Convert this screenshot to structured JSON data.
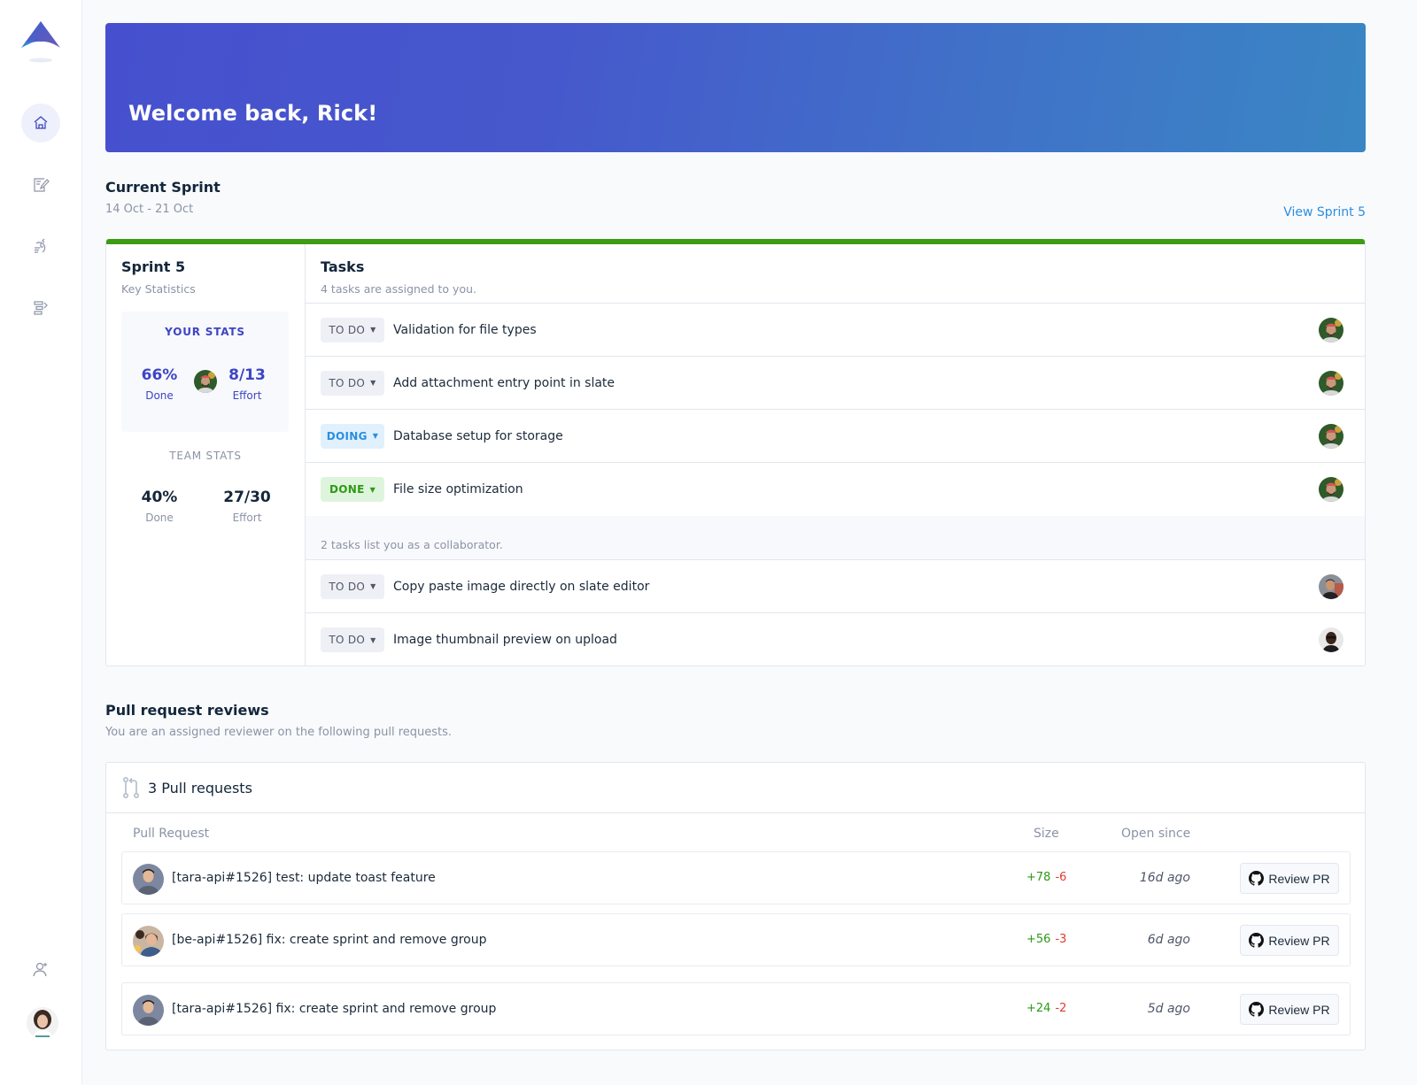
{
  "sidebar": {
    "nav": [
      {
        "icon": "home-icon",
        "active": true
      },
      {
        "icon": "edit-document-icon",
        "active": false
      },
      {
        "icon": "sprint-cycle-icon",
        "active": false
      },
      {
        "icon": "roadmap-icon",
        "active": false
      }
    ],
    "bottom": [
      {
        "icon": "add-user-icon"
      }
    ]
  },
  "banner": {
    "title": "Welcome back, Rick!"
  },
  "sprint_section": {
    "title": "Current Sprint",
    "dates": "14 Oct - 21 Oct",
    "view_link": "View Sprint 5"
  },
  "sprint_card": {
    "accent_color": "#3c9c14",
    "name": "Sprint 5",
    "subtitle": "Key Statistics",
    "your_stats": {
      "label": "YOUR STATS",
      "done_value": "66%",
      "done_caption": "Done",
      "effort_value": "8/13",
      "effort_caption": "Effort"
    },
    "team_stats": {
      "label": "TEAM STATS",
      "done_value": "40%",
      "done_caption": "Done",
      "effort_value": "27/30",
      "effort_caption": "Effort"
    }
  },
  "tasks": {
    "title": "Tasks",
    "assigned_sub": "4 tasks are assigned to you.",
    "assigned": [
      {
        "status": "TO DO",
        "title": "Validation for file types"
      },
      {
        "status": "TO DO",
        "title": "Add attachment entry point in slate"
      },
      {
        "status": "DOING",
        "title": "Database setup for storage"
      },
      {
        "status": "DONE",
        "title": "File size optimization"
      }
    ],
    "collab_sub": "2 tasks list you as a collaborator.",
    "collab": [
      {
        "status": "TO DO",
        "title": "Copy paste image directly on slate editor"
      },
      {
        "status": "TO DO",
        "title": "Image thumbnail preview on upload"
      }
    ]
  },
  "pr_section": {
    "title": "Pull request reviews",
    "subtitle": "You are an assigned reviewer on the following pull requests.",
    "count_label": "3 Pull requests",
    "columns": {
      "pr": "Pull Request",
      "size": "Size",
      "open": "Open since"
    },
    "rows": [
      {
        "title": "[tara-api#1526] test: update toast feature",
        "add": "+78",
        "del": "-6",
        "open": "16d ago",
        "button": "Review PR"
      },
      {
        "title": "[be-api#1526] fix: create sprint and remove group",
        "add": "+56",
        "del": "-3",
        "open": "6d ago",
        "button": "Review PR"
      },
      {
        "title": "[tara-api#1526] fix: create sprint and remove group",
        "add": "+24",
        "del": "-2",
        "open": "5d ago",
        "button": "Review PR"
      }
    ]
  },
  "colors": {
    "primary": "#3e45c4",
    "link": "#2a8fe0",
    "success": "#2c9a14",
    "danger": "#e23a2f"
  }
}
